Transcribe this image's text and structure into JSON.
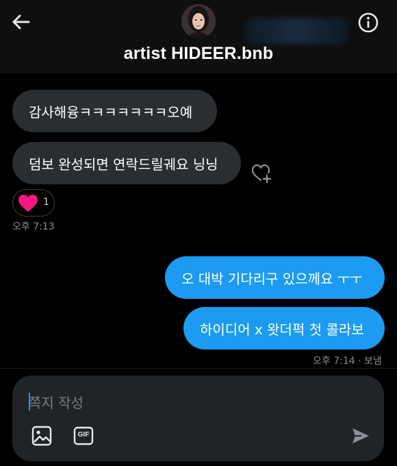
{
  "header": {
    "title": "artist HIDEER.bnb",
    "back_icon": "arrow-left-icon",
    "info_icon": "info-circle-icon"
  },
  "messages": [
    {
      "direction": "incoming",
      "text": "감사해융ㅋㅋㅋㅋㅋㅋㅋ오예"
    },
    {
      "direction": "incoming",
      "text": "덤보 완성되면 연락드릴궤요 닝닝"
    },
    {
      "direction": "outgoing",
      "text": "오 대박 기다리구 있으께요 ㅜㅜ"
    },
    {
      "direction": "outgoing",
      "text": "하이디어 x 왓더퍽 첫 콜라보"
    }
  ],
  "reaction": {
    "emoji": "heart",
    "count": "1"
  },
  "timestamps": {
    "incoming": "오후 7:13",
    "outgoing": "오후 7:14 · 보냄"
  },
  "composer": {
    "placeholder": "쪽지 작성",
    "image_icon": "image-icon",
    "gif_label": "GIF",
    "send_icon": "send-icon"
  },
  "colors": {
    "accent": "#1d9bf0",
    "incoming_bubble": "#2b2e31",
    "heart": "#f91880",
    "background": "#000000"
  }
}
